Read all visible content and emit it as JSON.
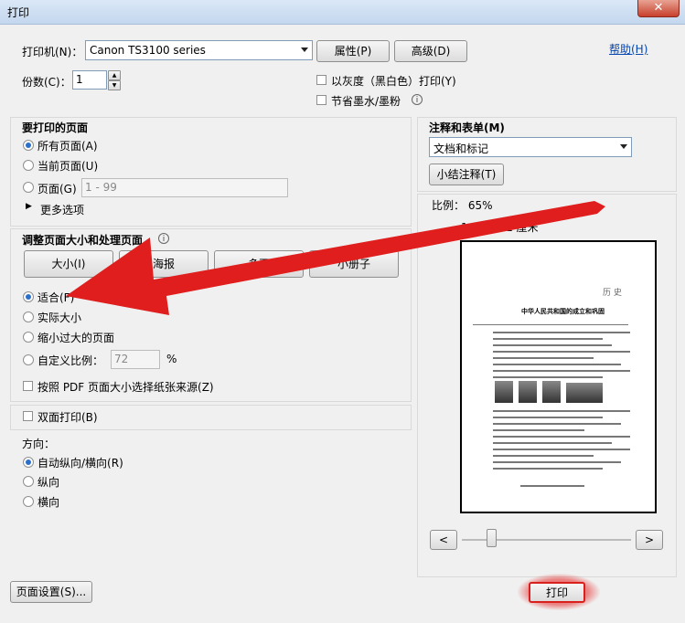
{
  "window": {
    "title": "打印",
    "close_glyph": "✕"
  },
  "printer": {
    "label": "打印机(N)：",
    "selected": "Canon TS3100 series",
    "properties_button": "属性(P)",
    "advanced_button": "高级(D)",
    "help_link": "帮助(H)"
  },
  "copies": {
    "label": "份数(C)：",
    "value": "1"
  },
  "options": {
    "grayscale": {
      "label": "以灰度（黑白色）打印(Y)",
      "checked": false
    },
    "save_ink": {
      "label": "节省墨水/墨粉",
      "checked": false
    }
  },
  "pages_to_print": {
    "heading": "要打印的页面",
    "all": "所有页面(A)",
    "current": "当前页面(U)",
    "pages": "页面(G)",
    "pages_placeholder": "1 - 99",
    "more_options": "更多选项",
    "selected": "all"
  },
  "sizing": {
    "heading": "调整页面大小和处理页面",
    "tabs": [
      "大小(I)",
      "海报",
      "多页",
      "小册子"
    ],
    "fit": "适合(F)",
    "actual": "实际大小",
    "shrink": "缩小过大的页面",
    "custom": "自定义比例：",
    "custom_value": "72",
    "percent": "%",
    "paper_source": "按照 PDF 页面大小选择纸张来源(Z)",
    "selected": "fit"
  },
  "duplex": {
    "label": "双面打印(B)",
    "checked": false
  },
  "orientation": {
    "heading": "方向：",
    "auto": "自动纵向/横向(R)",
    "portrait": "纵向",
    "landscape": "横向",
    "selected": "auto"
  },
  "comments": {
    "heading": "注释和表单(M)",
    "selected": "文档和标记",
    "summarize_button": "小结注释(T)"
  },
  "preview": {
    "scale": "比例： 65%",
    "size": "14.8 x 21 厘米",
    "prev": "<",
    "next": ">",
    "page_header": "历  史",
    "page_title": "中华人民共和国的成立和巩固"
  },
  "footer": {
    "page_setup": "页面设置(S)...",
    "print": "打印"
  },
  "colors": {
    "accent": "#2a6fc9",
    "arrow": "#e01e1e"
  }
}
